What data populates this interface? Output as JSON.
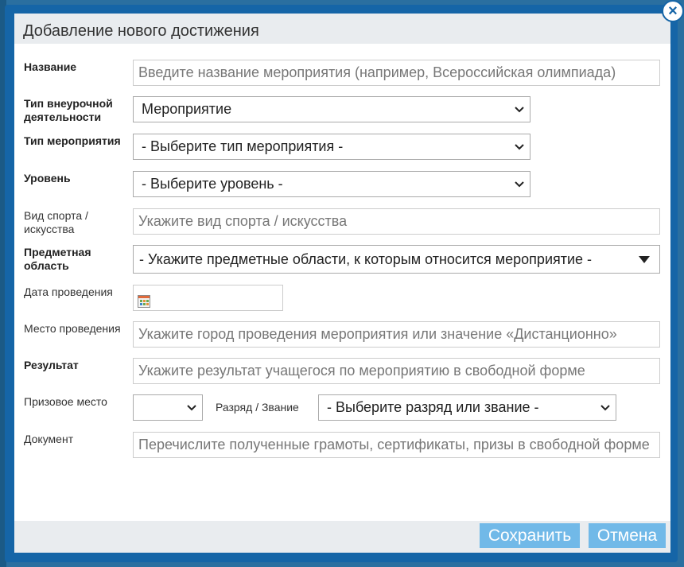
{
  "dialog": {
    "title": "Добавление нового достижения",
    "close_glyph": "×"
  },
  "form": {
    "name": {
      "label": "Название",
      "placeholder": "Введите название мероприятия (например, Всероссийская олимпиада)"
    },
    "activity_type": {
      "label": "Тип внеурочной деятельности",
      "value": "Мероприятие"
    },
    "event_type": {
      "label": "Тип мероприятия",
      "value": "- Выберите тип мероприятия -"
    },
    "level": {
      "label": "Уровень",
      "value": "- Выберите уровень -"
    },
    "sport": {
      "label": "Вид спорта / искусства",
      "placeholder": "Укажите вид спорта / искусства"
    },
    "subject": {
      "label": "Предметная область",
      "value": "- Укажите предметные области, к которым относится мероприятие -"
    },
    "date": {
      "label": "Дата проведения",
      "value": ""
    },
    "place": {
      "label": "Место проведения",
      "placeholder": "Укажите город проведения мероприятия или значение «Дистанционно»"
    },
    "result": {
      "label": "Результат",
      "placeholder": "Укажите результат учащегося по мероприятию в свободной форме"
    },
    "prize": {
      "label": "Призовое место",
      "value": ""
    },
    "rank": {
      "label": "Разряд / Звание",
      "value": "- Выберите разряд или звание -"
    },
    "document": {
      "label": "Документ",
      "placeholder": "Перечислите полученные грамоты, сертификаты, призы в свободной форме"
    }
  },
  "buttons": {
    "save": "Сохранить",
    "cancel": "Отмена"
  },
  "icons": {
    "close": "close-icon",
    "calendar": "calendar-icon",
    "chevron": "chevron-down-icon",
    "triangle": "caret-down-icon"
  },
  "colors": {
    "frame": "#1565a7",
    "button": "#71b9e8",
    "titlebar": "#e9ecef"
  }
}
